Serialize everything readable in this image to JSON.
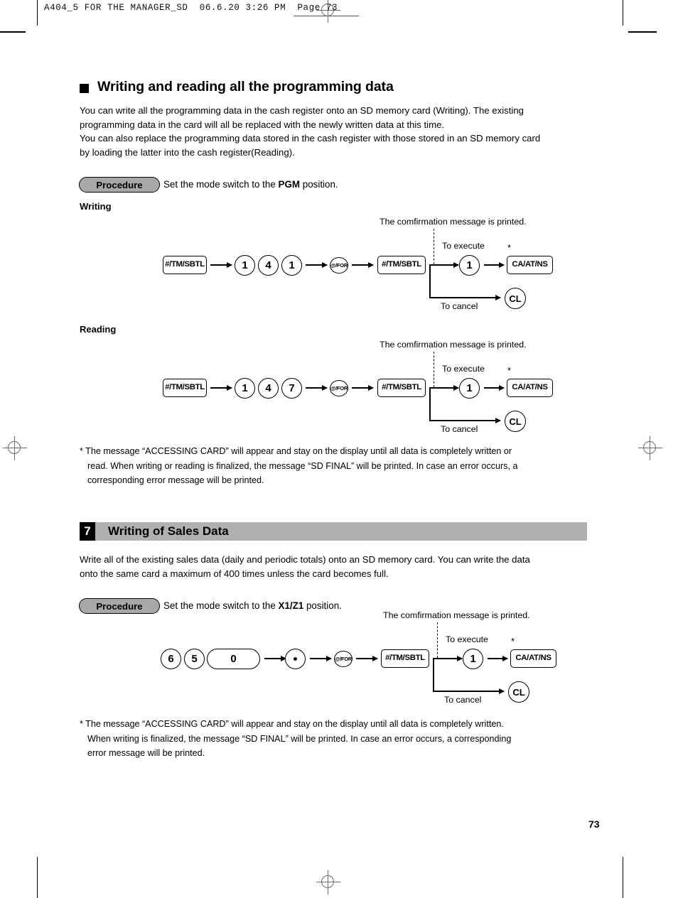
{
  "document": {
    "running_header": "A404_5 FOR THE MANAGER_SD  06.6.20 3:26 PM  Page 73",
    "page_number": "73"
  },
  "section_a": {
    "bullet_icon": "black-square-bullet",
    "heading": "Writing and reading all the programming data",
    "paragraph_lines": [
      "You can write all the programming data in the cash register onto an SD memory card (Writing). The existing",
      "programming data in the card will all be replaced with the newly written data at this time.",
      "You can also replace the programming data stored in the cash register with those stored in an SD memory card",
      "by loading the latter into the cash register(Reading)."
    ],
    "procedure": {
      "label": "Procedure",
      "instruction_pre": "Set the mode switch to the ",
      "instruction_bold": "PGM",
      "instruction_post": " position."
    },
    "writing_label": "Writing",
    "reading_label": "Reading",
    "footnote_lines": [
      "* The message “ACCESSING CARD” will appear and stay on the display until all data is completely written or",
      "read. When writing or reading is finalized, the message “SD FINAL” will be printed. In case an error occurs, a",
      "corresponding error message will be printed."
    ]
  },
  "diagram_writing": {
    "name": "writing-key-sequence",
    "keys": [
      "#/TM/SBTL",
      "1",
      "4",
      "1",
      "@/FOR",
      "#/TM/SBTL"
    ],
    "confirmation_note": "The comfirmation message is printed.",
    "execute_label": "To execute",
    "execute_keys": [
      "1",
      "CA/AT/NS"
    ],
    "cancel_label": "To cancel",
    "cancel_key": "CL",
    "asterisk": "*"
  },
  "diagram_reading": {
    "name": "reading-key-sequence",
    "keys": [
      "#/TM/SBTL",
      "1",
      "4",
      "7",
      "@/FOR",
      "#/TM/SBTL"
    ],
    "confirmation_note": "The comfirmation message is printed.",
    "execute_label": "To execute",
    "execute_keys": [
      "1",
      "CA/AT/NS"
    ],
    "cancel_label": "To cancel",
    "cancel_key": "CL",
    "asterisk": "*"
  },
  "section_b": {
    "number": "7",
    "title": "Writing of Sales Data",
    "paragraph_lines": [
      "Write all of the existing sales data (daily and periodic totals) onto an SD memory card. You can write the data",
      "onto the same card a maximum of 400 times unless the card becomes full."
    ],
    "procedure": {
      "label": "Procedure",
      "instruction_pre": "Set the mode switch to the ",
      "instruction_bold": "X1/Z1",
      "instruction_post": " position."
    },
    "footnote_lines": [
      "* The message “ACCESSING CARD” will appear and stay on the display until all data is completely written.",
      "When writing is finalized, the message “SD FINAL” will be printed. In case an error occurs, a corresponding",
      "error message will be printed."
    ]
  },
  "diagram_sales": {
    "name": "sales-data-key-sequence",
    "keys": [
      "6",
      "5",
      "0",
      "decimal-point",
      "@/FOR",
      "#/TM/SBTL"
    ],
    "confirmation_note": "The comfirmation message is printed.",
    "execute_label": "To execute",
    "execute_keys": [
      "1",
      "CA/AT/NS"
    ],
    "cancel_label": "To cancel",
    "cancel_key": "CL",
    "asterisk": "*"
  },
  "colors": {
    "section_bar": "#b0b0b0",
    "procedure_fill": "#a8a8a8",
    "ink": "#000000",
    "registration": "#6b6b6b"
  }
}
